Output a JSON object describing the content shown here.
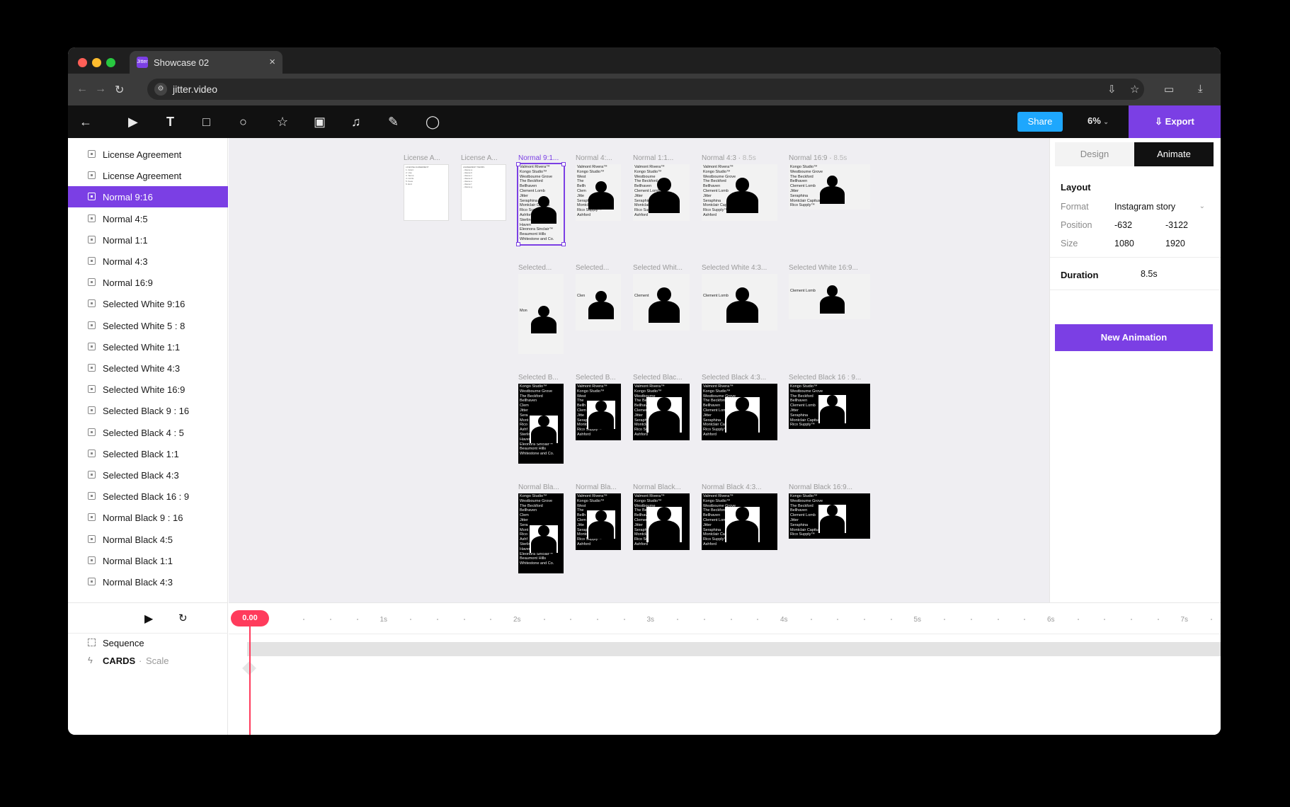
{
  "browser": {
    "tab_title": "Showcase 02",
    "favicon_text": "Jitter",
    "tab_close": "×",
    "url": "jitter.video",
    "nav_back": "←",
    "nav_forward": "→",
    "nav_reload": "↻"
  },
  "toolbar": {
    "share_label": "Share",
    "zoom_label": "6%",
    "export_label": "Export",
    "tools": [
      "back-arrow-icon",
      "play-frame-icon",
      "text-tool-icon",
      "rectangle-tool-icon",
      "ellipse-tool-icon",
      "star-tool-icon",
      "image-tool-icon",
      "audio-tool-icon",
      "pen-tool-icon",
      "comment-tool-icon"
    ]
  },
  "layers": [
    {
      "label": "License Agreement"
    },
    {
      "label": "License Agreement"
    },
    {
      "label": "Normal 9:16",
      "selected": true
    },
    {
      "label": "Normal 4:5"
    },
    {
      "label": "Normal 1:1"
    },
    {
      "label": "Normal 4:3"
    },
    {
      "label": "Normal 16:9"
    },
    {
      "label": "Selected White 9:16"
    },
    {
      "label": "Selected White 5 : 8"
    },
    {
      "label": "Selected White 1:1"
    },
    {
      "label": "Selected White 4:3"
    },
    {
      "label": "Selected White 16:9"
    },
    {
      "label": "Selected Black 9 : 16"
    },
    {
      "label": "Selected Black 4 : 5"
    },
    {
      "label": "Selected Black 1:1"
    },
    {
      "label": "Selected Black 4:3"
    },
    {
      "label": "Selected Black 16 : 9"
    },
    {
      "label": "Normal Black 9 : 16"
    },
    {
      "label": "Normal Black 4:5"
    },
    {
      "label": "Normal Black 1:1"
    },
    {
      "label": "Normal Black 4:3"
    }
  ],
  "canvas": {
    "frames": [
      {
        "label": "License A...",
        "theme": "lic",
        "text": "LICENSE AGREEMENT\n1. Grant\n2. Use\n3. Terms\n4. Limits\n5. Fees\n6. End"
      },
      {
        "label": "License A...",
        "theme": "lic",
        "text": "AGREEMENT TERMS\n- clause a\n- clause b\n- clause c\n- clause d\n- clause e\n- clause f\n- clause g"
      },
      {
        "label": "Normal 9:1...",
        "theme": "white",
        "selected": true,
        "text": "Valmont Rivera™\nKongo Studio™\nWestbourne Grove\nThe Beckford\nBellhaven\nClement Lomb\nJitter\nSeraphina\nMontclair Capitus\nRico Supply™\nAshford\nSterling Cutting\nHaven\nEleonora Sinclair™\nBeaumont Hills\nWhitestone and Co."
      },
      {
        "label": "Normal 4:...",
        "theme": "white",
        "text": "Valmont Rivera™\nKongo Studio™\nWest\nThe\nBellh\nClem\nJitte\nSeraphina\nMontclair Capitus\nRico Supply™\nAshford"
      },
      {
        "label": "Normal 1:1...",
        "theme": "white",
        "text": "Valmont Rivera™\nKongo Studio™\nWestbourne\nThe Beckford\nBellhaven\nClement Lomb\nJitter\nSeraphina\nMontclair Capitus\nRico Supply™\nAshford"
      },
      {
        "label": "Normal 4:3",
        "dur": "8.5s",
        "theme": "white",
        "text": "Valmont Rivera™\nKongo Studio™\nWestbourne Grove\nThe Beckford\nBellhaven\nClement Lomb\nJitter\nSeraphina\nMontclair Capitus\nRico Supply™\nAshford"
      },
      {
        "label": "Normal 16:9",
        "dur": "8.5s",
        "theme": "white",
        "text": "Kongo Studio™\nWestbourne Grove\nThe Beckford\nBellhaven\nClement Lomb\nJitter\nSeraphina\nMontclair Capitus\nRico Supply™"
      },
      {
        "label": "Selected...",
        "theme": "white",
        "text": "\n\n\n\n\n\n\nMon"
      },
      {
        "label": "Selected...",
        "theme": "white",
        "text": "\n\n\n\nClen"
      },
      {
        "label": "Selected Whit...",
        "theme": "white",
        "text": "\n\n\n\nClement"
      },
      {
        "label": "Selected White 4:3...",
        "theme": "white",
        "text": "\n\n\n\nClement Lomb"
      },
      {
        "label": "Selected White 16:9...",
        "theme": "white",
        "text": "\n\n\nClement Lomb"
      },
      {
        "label": "Selected B...",
        "theme": "black",
        "text": "Kongo Studio™\nWestbourne Grove\nThe Beckford\nBellhaven\nClem\nJitter\nSera\nMont\nRico\nAshf\nSterling Cutting\nHaven\nEleonora Sinclair™\nBeaumont Hills\nWhitestone and Co."
      },
      {
        "label": "Selected B...",
        "theme": "black",
        "text": "Valmont Rivera™\nKongo Studio™\nWest\nThe\nBellh\nClem\nJitte\nSeraphina\nMontclair Capitus\nRico Supply™\nAshford"
      },
      {
        "label": "Selected Blac...",
        "theme": "black",
        "text": "Valmont Rivera™\nKongo Studio™\nWestbourne\nThe Beckford\nBellhaven\nClement\nJitter\nSeraphina\nMontclair Capitus\nRico Supply™\nAshford"
      },
      {
        "label": "Selected Black 4:3...",
        "theme": "black",
        "text": "Valmont Rivera™\nKongo Studio™\nWestbourne Grove\nThe Beckford\nBellhaven\nClement Lomb\nJitter\nSeraphina\nMontclair Capitus\nRico Supply™\nAshford"
      },
      {
        "label": "Selected Black 16 : 9...",
        "theme": "black",
        "text": "Kongo Studio™\nWestbourne Grove\nThe Beckford\nBellhaven\nClement Lomb\nJitter\nSeraphina\nMontclair Capitus\nRico Supply™"
      },
      {
        "label": "Normal Bla...",
        "theme": "black",
        "text": "Kongo Studio™\nWestbourne Grove\nThe Beckford\nBellhaven\nClem\nJitter\nSera\nMont\nRico\nAshf\nSterling Cutting\nHaven\nEleonora Sinclair™\nBeaumont Hills\nWhitestone and Co."
      },
      {
        "label": "Normal Bla...",
        "theme": "black",
        "text": "Valmont Rivera™\nKongo Studio™\nWest\nThe\nBellh\nClem\nJitte\nSeraphina\nMontclair Capitus\nRico Supply™\nAshford"
      },
      {
        "label": "Normal Black...",
        "theme": "black",
        "text": "Valmont Rivera™\nKongo Studio™\nWestbourne\nThe Beckford\nBellhaven\nClement\nJitter\nSeraphina\nMontclair Capitus\nRico Supply™\nAshford"
      },
      {
        "label": "Normal Black 4:3...",
        "theme": "black",
        "text": "Valmont Rivera™\nKongo Studio™\nWestbourne Grove\nThe Beckford\nBellhaven\nClement Lomb\nJitter\nSeraphina\nMontclair Capitus\nRico Supply™\nAshford"
      },
      {
        "label": "Normal Black 16:9...",
        "theme": "black",
        "text": "Kongo Studio™\nWestbourne Grove\nThe Beckford\nBellhaven\nClement Lomb\nJitter\nSeraphina\nMontclair Capitus\nRico Supply™"
      }
    ]
  },
  "panel": {
    "tab_design": "Design",
    "tab_animate": "Animate",
    "layout_title": "Layout",
    "format_label": "Format",
    "format_value": "Instagram story",
    "position_label": "Position",
    "position_x": "-632",
    "position_y": "-3122",
    "size_label": "Size",
    "size_w": "1080",
    "size_h": "1920",
    "duration_label": "Duration",
    "duration_value": "8.5s",
    "new_animation_label": "New Animation"
  },
  "timeline": {
    "playhead": "0.00",
    "ticks": [
      "1s",
      "2s",
      "3s",
      "4s",
      "5s",
      "6s",
      "7s"
    ],
    "sequence_label": "Sequence",
    "cards_label": "CARDS",
    "cards_sep": "·",
    "cards_sub": "Scale"
  },
  "colors": {
    "accent": "#7b3fe4",
    "share": "#1ea7fd",
    "playhead": "#ff3b5c"
  }
}
